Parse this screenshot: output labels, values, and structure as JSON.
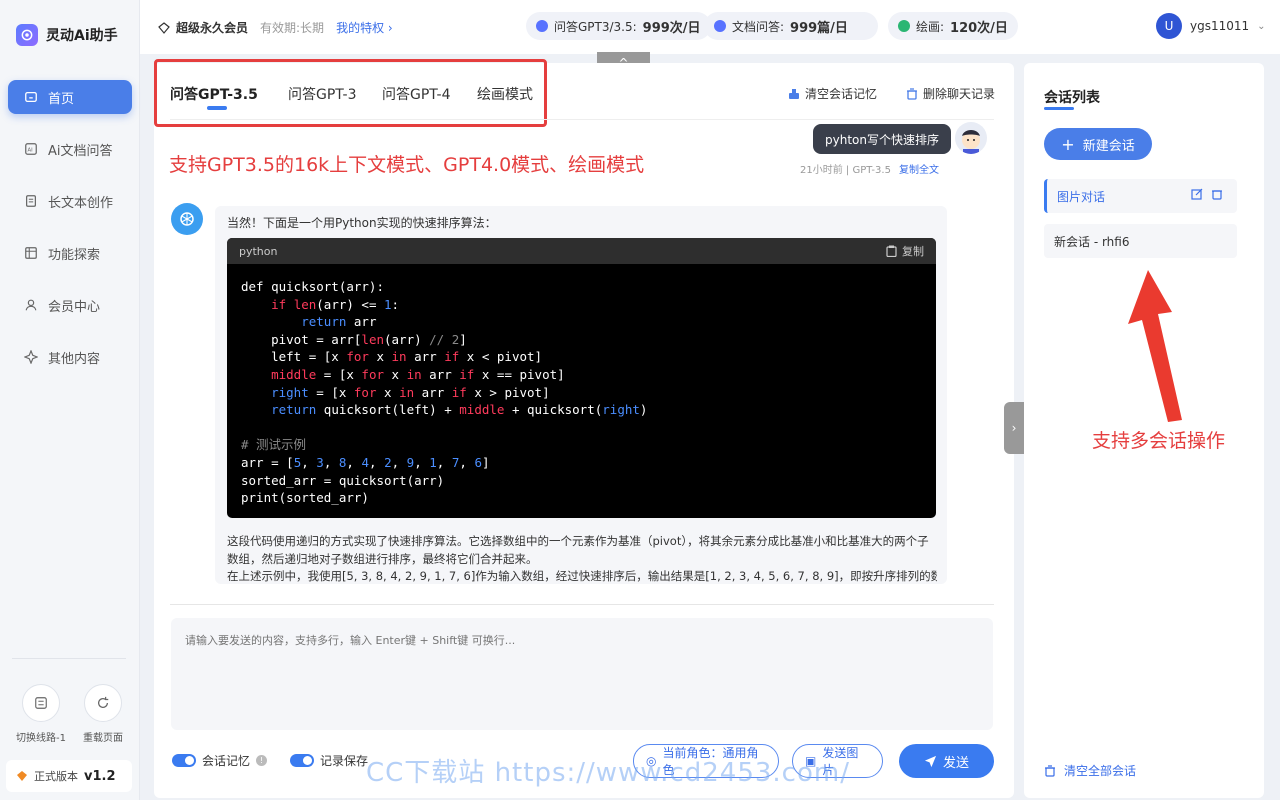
{
  "app": {
    "name": "灵动Ai助手"
  },
  "sidebar": {
    "items": [
      {
        "label": "首页",
        "icon": "home-icon"
      },
      {
        "label": "Ai文档问答",
        "icon": "document-ai-icon"
      },
      {
        "label": "长文本创作",
        "icon": "file-text-icon"
      },
      {
        "label": "功能探索",
        "icon": "grid-icon"
      },
      {
        "label": "会员中心",
        "icon": "user-icon"
      },
      {
        "label": "其他内容",
        "icon": "sparkle-icon"
      }
    ],
    "tools": [
      {
        "label": "切换线路-1"
      },
      {
        "label": "重载页面"
      }
    ],
    "version_label": "正式版本",
    "version": "v1.2"
  },
  "topbar": {
    "member": "超级永久会员",
    "validity": "有效期:长期",
    "privilege_link": "我的特权",
    "quotas": [
      {
        "label": "问答GPT3/3.5:",
        "value": "999次/日"
      },
      {
        "label": "文档问答:",
        "value": "999篇/日"
      },
      {
        "label": "绘画:",
        "value": "120次/日"
      }
    ],
    "avatar_letter": "U",
    "username": "ygs11011"
  },
  "tabs": [
    {
      "label": "问答GPT-3.5"
    },
    {
      "label": "问答GPT-3"
    },
    {
      "label": "问答GPT-4"
    },
    {
      "label": "绘画模式"
    }
  ],
  "actions": {
    "clear_memory": "清空会话记忆",
    "delete_history": "删除聊天记录"
  },
  "annotations": {
    "top": "支持GPT3.5的16k上下文模式、GPT4.0模式、绘画模式",
    "right": "支持多会话操作"
  },
  "user_msg": {
    "text": "pyhton写个快速排序",
    "meta": "21小时前 | GPT-3.5",
    "copy_all": "复制全文"
  },
  "reply": {
    "intro": "当然！下面是一个用Python实现的快速排序算法：",
    "code_lang": "python",
    "copy": "复制",
    "para1": "这段代码使用递归的方式实现了快速排序算法。它选择数组中的一个元素作为基准（pivot），将其余元素分成比基准小和比基准大的两个子数组，然后递归地对子数组进行排序，最终将它们合并起来。",
    "para2": "在上述示例中，我使用[5, 3, 8, 4, 2, 9, 1, 7, 6]作为输入数组，经过快速排序后，输出结果是[1, 2, 3, 4, 5, 6, 7, 8, 9]，即按升序排列的数"
  },
  "input": {
    "placeholder": "请输入要发送的内容，支持多行，输入 Enter键 + Shift键 可换行..."
  },
  "bottom": {
    "memory_label": "会话记忆",
    "save_label": "记录保存",
    "role_btn": "当前角色：通用角色",
    "image_btn": "发送图片",
    "send_btn": "发送"
  },
  "conversations": {
    "title": "会话列表",
    "new_btn": "新建会话",
    "items": [
      {
        "label": "图片对话"
      },
      {
        "label": "新会话 - rhfi6"
      }
    ],
    "clear_all": "清空全部会话"
  },
  "watermark": "CC下载站 https://www.cd2453.com/"
}
